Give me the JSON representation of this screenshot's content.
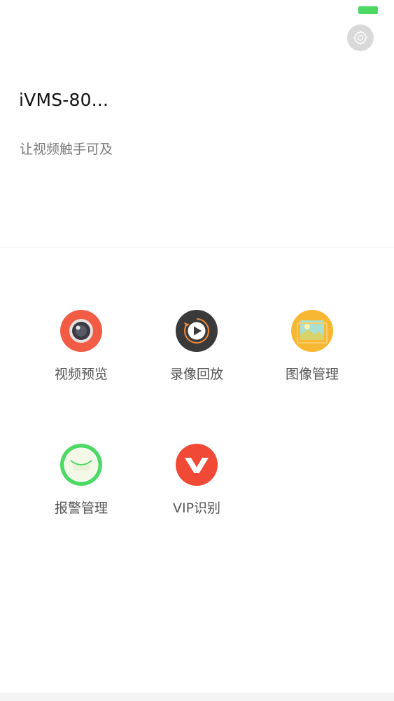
{
  "header": {
    "title": "iVMS-80...",
    "subtitle": "让视频触手可及",
    "settings_icon": "gear-icon"
  },
  "status_bar": {
    "battery_color": "#4cd964"
  },
  "menu": {
    "items": [
      {
        "label": "视频预览",
        "icon": "camera-lens-icon",
        "color": "#f25c45"
      },
      {
        "label": "录像回放",
        "icon": "replay-play-icon",
        "color": "#3a3a3a"
      },
      {
        "label": "图像管理",
        "icon": "image-gallery-icon",
        "color": "#f7b733"
      },
      {
        "label": "报警管理",
        "icon": "alarm-envelope-icon",
        "color": "#4cd964"
      },
      {
        "label": "VIP识别",
        "icon": "vip-v-icon",
        "color": "#f04a36"
      }
    ]
  }
}
